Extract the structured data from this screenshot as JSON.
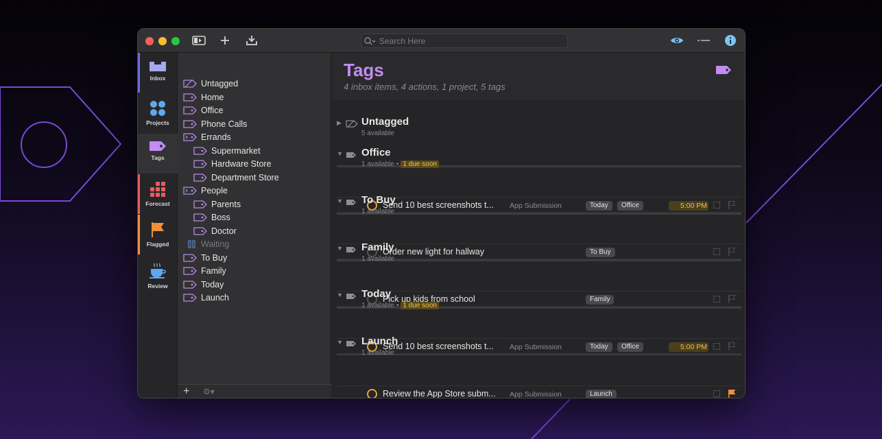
{
  "toolbar": {
    "search_placeholder": "Search Here"
  },
  "rail": {
    "items": [
      {
        "label": "Inbox"
      },
      {
        "label": "Projects"
      },
      {
        "label": "Tags"
      },
      {
        "label": "Forecast"
      },
      {
        "label": "Flagged"
      },
      {
        "label": "Review"
      }
    ]
  },
  "sidebar": {
    "tags": [
      {
        "label": "Untagged"
      },
      {
        "label": "Home"
      },
      {
        "label": "Office"
      },
      {
        "label": "Phone Calls"
      },
      {
        "label": "Errands"
      },
      {
        "label": "Supermarket"
      },
      {
        "label": "Hardware Store"
      },
      {
        "label": "Department Store"
      },
      {
        "label": "People"
      },
      {
        "label": "Parents"
      },
      {
        "label": "Boss"
      },
      {
        "label": "Doctor"
      },
      {
        "label": "Waiting"
      },
      {
        "label": "To Buy"
      },
      {
        "label": "Family"
      },
      {
        "label": "Today"
      },
      {
        "label": "Launch"
      }
    ]
  },
  "main": {
    "title": "Tags",
    "subtitle": "4 inbox items, 4 actions, 1 project, 5 tags",
    "groups": [
      {
        "title": "Untagged",
        "available": "5 available",
        "due": ""
      },
      {
        "title": "Office",
        "available": "1 available",
        "separator": "•",
        "due": "1 due soon",
        "actions": [
          {
            "title": "Send 10 best screenshots t...",
            "project": "App Submission",
            "tags": [
              "Today",
              "Office"
            ],
            "time": "5:00 PM"
          }
        ]
      },
      {
        "title": "To Buy",
        "available": "1 available",
        "due": "",
        "actions": [
          {
            "title": "Order new light for hallway",
            "project": "",
            "tags": [
              "To Buy"
            ],
            "time": ""
          }
        ]
      },
      {
        "title": "Family",
        "available": "1 available",
        "due": "",
        "actions": [
          {
            "title": "Pick up kids from school",
            "project": "",
            "tags": [
              "Family"
            ],
            "time": ""
          }
        ]
      },
      {
        "title": "Today",
        "available": "1 available",
        "separator": "•",
        "due": "1 due soon",
        "actions": [
          {
            "title": "Send 10 best screenshots t...",
            "project": "App Submission",
            "tags": [
              "Today",
              "Office"
            ],
            "time": "5:00 PM"
          }
        ]
      },
      {
        "title": "Launch",
        "available": "1 available",
        "due": "",
        "actions": [
          {
            "title": "Review the App Store subm...",
            "project": "App Submission",
            "tags": [
              "Launch"
            ],
            "time": ""
          }
        ]
      }
    ]
  },
  "colors": {
    "accent": "#c48cf2",
    "due_soon": "#f2c14a",
    "flag": "#f0913a"
  }
}
